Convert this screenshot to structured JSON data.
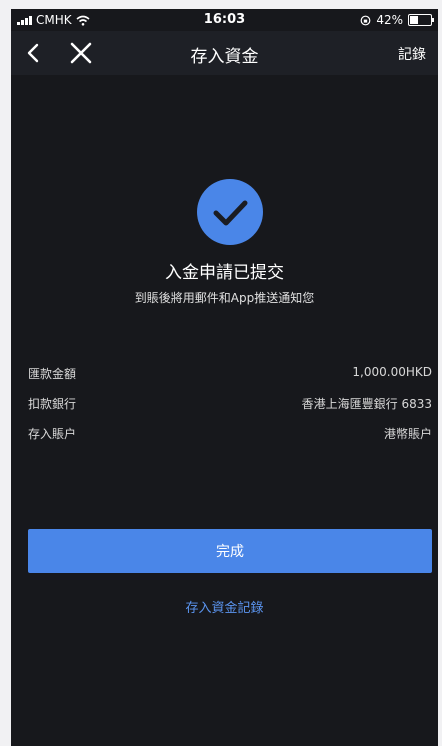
{
  "status_bar": {
    "carrier": "CMHK",
    "time": "16:03",
    "battery": "42%"
  },
  "nav": {
    "title": "存入資金",
    "records_label": "記錄"
  },
  "result": {
    "title": "入金申請已提交",
    "subtitle": "到賬後將用郵件和App推送通知您"
  },
  "details": [
    {
      "label": "匯款金額",
      "value": "1,000.00HKD"
    },
    {
      "label": "扣款銀行",
      "value": "香港上海匯豐銀行 6833"
    },
    {
      "label": "存入賬户",
      "value": "港幣賬户"
    }
  ],
  "actions": {
    "done_label": "完成",
    "records_link": "存入資金記錄"
  },
  "colors": {
    "background": "#17181c",
    "navbar": "#1e2026",
    "accent": "#4a86e8"
  }
}
